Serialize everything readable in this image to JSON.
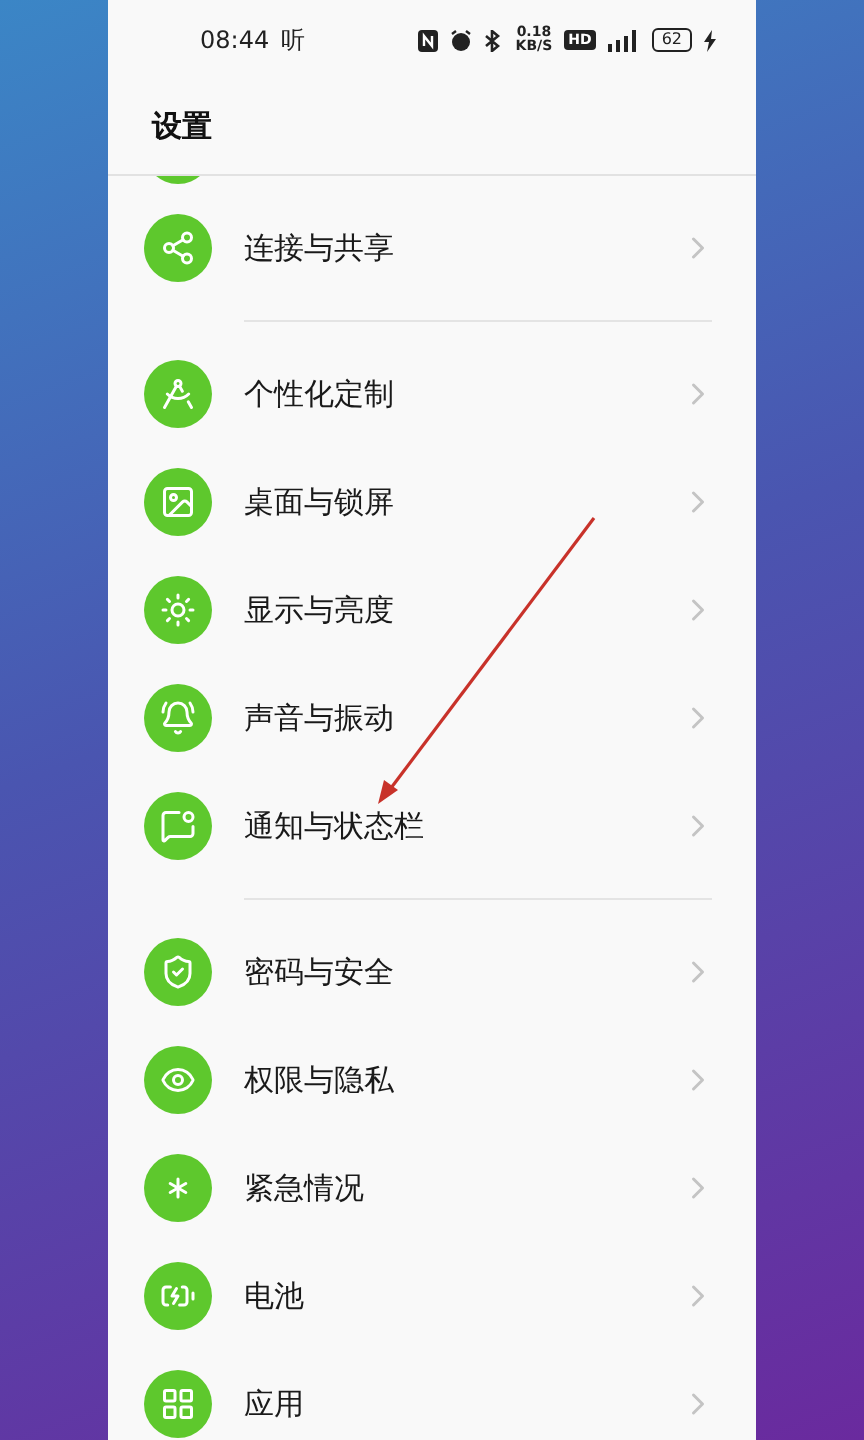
{
  "status_bar": {
    "time": "08:44",
    "notification": "听",
    "speed_value": "0.18",
    "speed_unit": "KB/S",
    "hd_badge": "HD",
    "battery": "62"
  },
  "title": "设置",
  "sections": [
    {
      "items": [
        {
          "label": "连接与共享"
        }
      ]
    },
    {
      "items": [
        {
          "label": "个性化定制"
        },
        {
          "label": "桌面与锁屏"
        },
        {
          "label": "显示与亮度"
        },
        {
          "label": "声音与振动"
        },
        {
          "label": "通知与状态栏"
        }
      ]
    },
    {
      "items": [
        {
          "label": "密码与安全"
        },
        {
          "label": "权限与隐私"
        },
        {
          "label": "紧急情况"
        },
        {
          "label": "电池"
        },
        {
          "label": "应用"
        }
      ]
    }
  ]
}
